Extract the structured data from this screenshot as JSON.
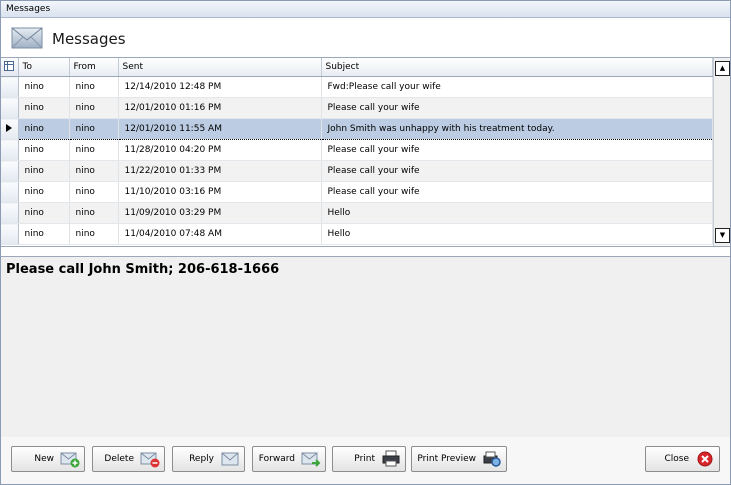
{
  "window": {
    "title": "Messages"
  },
  "header": {
    "title": "Messages",
    "icon": "envelope-icon"
  },
  "grid": {
    "columns": [
      "To",
      "From",
      "Sent",
      "Subject"
    ],
    "rows": [
      {
        "to": "nino",
        "from": "nino",
        "sent": "12/14/2010 12:48 PM",
        "subject": "Fwd:Please call your wife"
      },
      {
        "to": "nino",
        "from": "nino",
        "sent": "12/01/2010 01:16 PM",
        "subject": "Please call your wife"
      },
      {
        "to": "nino",
        "from": "nino",
        "sent": "12/01/2010 11:55 AM",
        "subject": "John Smith was unhappy with his treatment today."
      },
      {
        "to": "nino",
        "from": "nino",
        "sent": "11/28/2010 04:20 PM",
        "subject": "Please call your wife"
      },
      {
        "to": "nino",
        "from": "nino",
        "sent": "11/22/2010 01:33 PM",
        "subject": "Please call your wife"
      },
      {
        "to": "nino",
        "from": "nino",
        "sent": "11/10/2010 03:16 PM",
        "subject": "Please call your wife"
      },
      {
        "to": "nino",
        "from": "nino",
        "sent": "11/09/2010 03:29 PM",
        "subject": "Hello"
      },
      {
        "to": "nino",
        "from": "nino",
        "sent": "11/04/2010 07:48 AM",
        "subject": "Hello"
      }
    ],
    "selected_index": 2
  },
  "preview": {
    "text": "Please call John Smith; 206-618-1666"
  },
  "toolbar": {
    "new": "New",
    "delete": "Delete",
    "reply": "Reply",
    "forward": "Forward",
    "print": "Print",
    "print_preview": "Print Preview",
    "close": "Close"
  },
  "colors": {
    "selected_row": "#bccde3",
    "close_icon": "#d9262b",
    "new_icon": "#3aa63a",
    "delete_icon": "#d33"
  }
}
